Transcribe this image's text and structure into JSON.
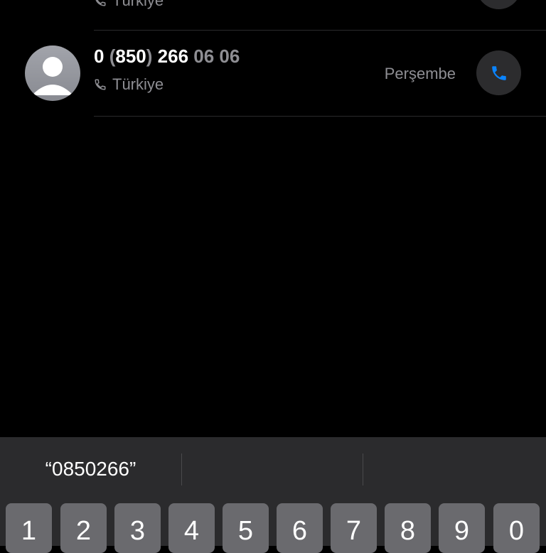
{
  "recents": [
    {
      "number_parts": [],
      "subtitle": "Türkiye",
      "icon": "person-avatar-icon"
    },
    {
      "number_parts": [
        {
          "text": "0 ",
          "dim": false
        },
        {
          "text": "(",
          "dim": true
        },
        {
          "text": "850",
          "dim": false
        },
        {
          "text": ")",
          "dim": true
        },
        {
          "text": " 266 ",
          "dim": false
        },
        {
          "text": "06 06",
          "dim": true
        }
      ],
      "subtitle": "Türkiye",
      "day": "Perşembe",
      "icon": "person-avatar-icon"
    }
  ],
  "keyboard": {
    "suggestions": [
      "“0850266”",
      "",
      ""
    ],
    "keys": [
      "1",
      "2",
      "3",
      "4",
      "5",
      "6",
      "7",
      "8",
      "9",
      "0"
    ]
  },
  "colors": {
    "background": "#000000",
    "secondary_text": "#8e8e93",
    "call_icon": "#0a84ff",
    "keyboard_bg": "#2b2b2d",
    "key_bg": "#6a6a6e"
  }
}
